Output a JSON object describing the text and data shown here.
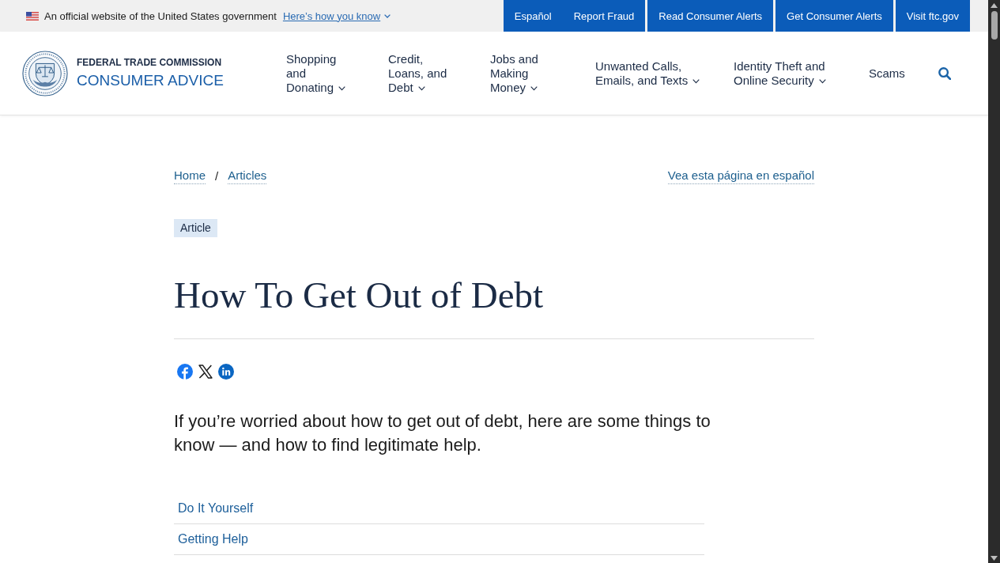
{
  "gov_banner": {
    "text": "An official website of the United States government",
    "link": "Here’s how you know"
  },
  "top_links": [
    "Español",
    "Report Fraud",
    "Read Consumer Alerts",
    "Get Consumer Alerts",
    "Visit ftc.gov"
  ],
  "header": {
    "agency": "FEDERAL TRADE COMMISSION",
    "site": "CONSUMER ADVICE",
    "nav": [
      {
        "label": "Shopping and Donating",
        "has_menu": true
      },
      {
        "label": "Credit, Loans, and Debt",
        "has_menu": true
      },
      {
        "label": "Jobs and Making Money",
        "has_menu": true
      },
      {
        "label": "Unwanted Calls, Emails, and Texts",
        "has_menu": true
      },
      {
        "label": "Identity Theft and Online Security",
        "has_menu": true
      },
      {
        "label": "Scams",
        "has_menu": false
      }
    ]
  },
  "breadcrumb": {
    "items": [
      "Home",
      "Articles"
    ],
    "separator": "/"
  },
  "language_link": "Vea esta página en español",
  "tag": "Article",
  "title": "How To Get Out of Debt",
  "share": [
    {
      "kind": "facebook"
    },
    {
      "kind": "x"
    },
    {
      "kind": "linkedin"
    }
  ],
  "lead": "If you’re worried about how to get out of debt, here are some things to know — and how to find legitimate help.",
  "toc": [
    "Do It Yourself",
    "Getting Help"
  ]
}
